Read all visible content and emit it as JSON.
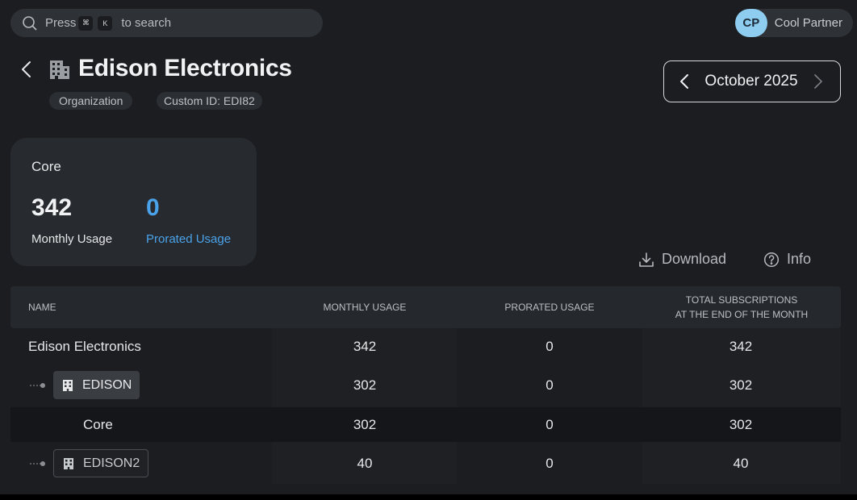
{
  "search": {
    "prefix": "Press",
    "key1": "⌘",
    "key2": "K",
    "suffix": "to search"
  },
  "user": {
    "initials": "CP",
    "name": "Cool Partner"
  },
  "header": {
    "title": "Edison Electronics",
    "chip_type": "Organization",
    "chip_custom_id": "Custom ID: EDI82",
    "month": "October 2025"
  },
  "card": {
    "name": "Core",
    "monthly_value": "342",
    "monthly_label": "Monthly Usage",
    "prorated_value": "0",
    "prorated_label": "Prorated Usage"
  },
  "actions": {
    "download": "Download",
    "info": "Info"
  },
  "table": {
    "headers": {
      "name": "NAME",
      "monthly": "MONTHLY USAGE",
      "prorated": "PRORATED USAGE",
      "total_line1": "TOTAL SUBSCRIPTIONS",
      "total_line2": "AT THE END OF THE MONTH"
    },
    "rows": [
      {
        "name": "Edison Electronics",
        "monthly": "342",
        "prorated": "0",
        "total": "342"
      },
      {
        "name": "EDISON",
        "monthly": "302",
        "prorated": "0",
        "total": "302"
      },
      {
        "name": "Core",
        "monthly": "302",
        "prorated": "0",
        "total": "302"
      },
      {
        "name": "EDISON2",
        "monthly": "40",
        "prorated": "0",
        "total": "40"
      }
    ]
  },
  "colors": {
    "accent_blue": "#4aa3ea",
    "avatar_bg": "#8ecdf0",
    "background": "#1b1d20"
  }
}
